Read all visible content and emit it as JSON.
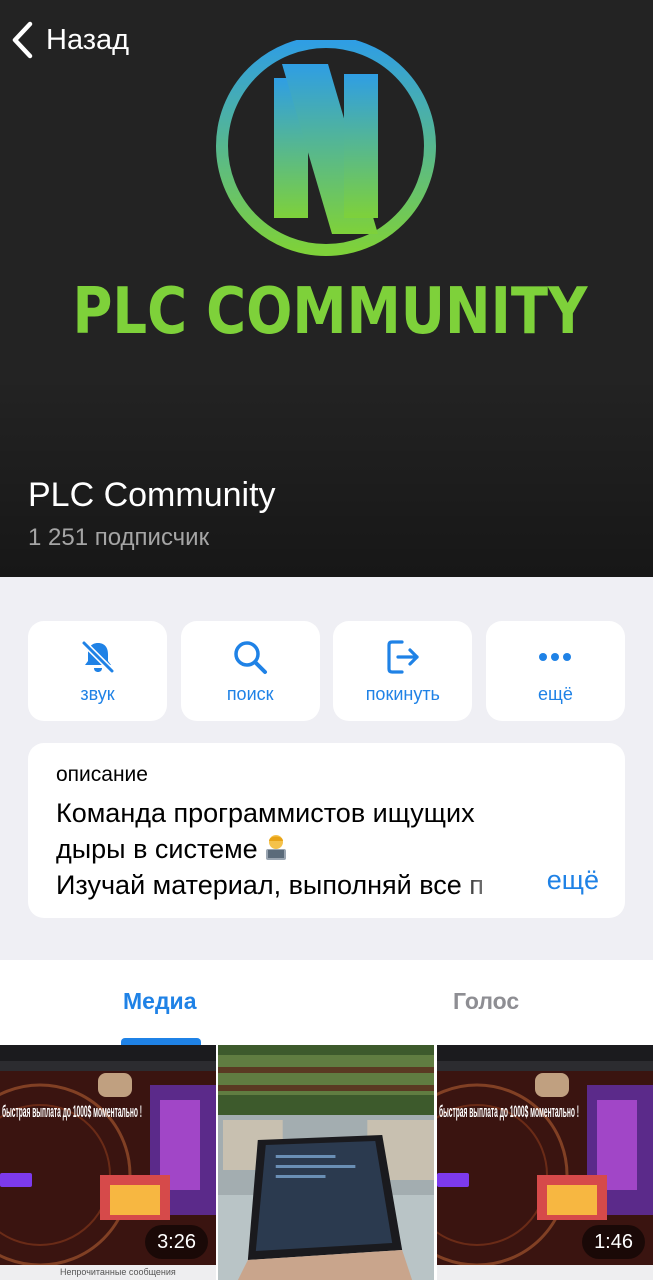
{
  "nav": {
    "back_label": "Назад"
  },
  "header": {
    "logo_text": "PLC COMMUNITY",
    "title": "PLC Community",
    "subscribers": "1 251 подписчик"
  },
  "actions": [
    {
      "label": "звук",
      "icon": "bell-slash-icon"
    },
    {
      "label": "поиск",
      "icon": "search-icon"
    },
    {
      "label": "покинуть",
      "icon": "leave-icon"
    },
    {
      "label": "ещё",
      "icon": "more-icon"
    }
  ],
  "description": {
    "label": "описание",
    "line1": "Команда программистов ищущих",
    "line2": "дыры в системе",
    "line3": "Изучай материал, выполняй все п",
    "more": "ещё"
  },
  "tabs": [
    {
      "label": "Медиа",
      "active": true
    },
    {
      "label": "Голос",
      "active": false
    }
  ],
  "media": [
    {
      "type": "video",
      "duration": "3:26",
      "caption": "быстрая выплата до 1000$ моментально !",
      "strip": "Непрочитанные сообщения"
    },
    {
      "type": "photo",
      "duration": "",
      "caption": "",
      "strip": ""
    },
    {
      "type": "video",
      "duration": "1:46",
      "caption": "быстрая выплата до 1000$ моментально !",
      "strip": ""
    }
  ],
  "colors": {
    "accent": "#1f82e6",
    "header_bg": "#232323",
    "logo_green": "#7ed13a",
    "logo_blue": "#2f9ee4",
    "page_bg": "#efeff4"
  }
}
